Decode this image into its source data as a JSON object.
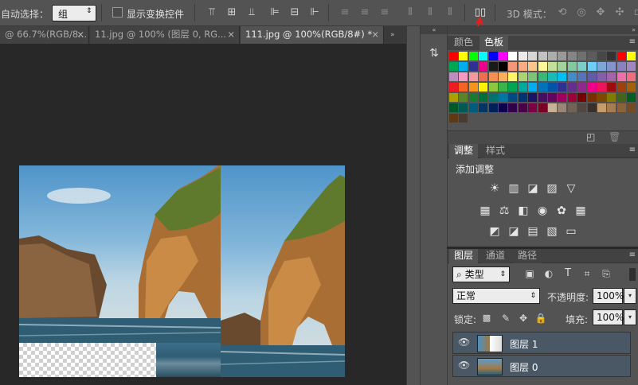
{
  "options_bar": {
    "auto_select_label": "自动选择：",
    "auto_select_value": "组",
    "show_transform_label": "显示变换控件",
    "mode_3d_label": "3D 模式："
  },
  "doc_tabs": [
    {
      "label": "@ 66.7%(RGB/8...",
      "close": "×"
    },
    {
      "label": "11.jpg @ 100% (图层 0, RG...",
      "close": "×"
    },
    {
      "label": "111.jpg @ 100%(RGB/8#) *",
      "close": "×"
    }
  ],
  "swatches_panel": {
    "tab_color": "颜色",
    "tab_swatches": "色板",
    "colors": [
      [
        "#ff0000",
        "#ffff00",
        "#00ff00",
        "#00ffff",
        "#0000ff",
        "#ff00ff",
        "#ffffff",
        "#ebebeb",
        "#d6d6d6",
        "#c2c2c2",
        "#adadad",
        "#999999",
        "#858585",
        "#707070",
        "#5c5c5c",
        "#474747",
        "#333333",
        "#ff0000",
        "#ffff00"
      ],
      [
        "#00a651",
        "#00aeef",
        "#2e3192",
        "#ec008c",
        "#1a1a1a",
        "#000000",
        "#f7977a",
        "#f9ad81",
        "#fdc68a",
        "#fff79a",
        "#c4df9b",
        "#a3d39c",
        "#82ca9d",
        "#7bcdc8",
        "#6ecff6",
        "#7ea7d8",
        "#8493ca",
        "#8882be",
        "#a187be"
      ],
      [
        "#bc8dbf",
        "#f49ac2",
        "#f6989d",
        "#f26c4f",
        "#f68e55",
        "#fbaf5c",
        "#fff467",
        "#acd372",
        "#7cc576",
        "#3bb878",
        "#1abbb4",
        "#00bff3",
        "#438cca",
        "#5574b9",
        "#605ca8",
        "#855fa8",
        "#a763a8",
        "#f06ea9",
        "#f26d7d"
      ],
      [
        "#ed1c24",
        "#f26522",
        "#f7941d",
        "#fff200",
        "#8dc73f",
        "#39b54a",
        "#00a651",
        "#00a99d",
        "#00aeef",
        "#0072bc",
        "#0054a6",
        "#2e3192",
        "#662d91",
        "#92278f",
        "#ec008c",
        "#ed145b",
        "#9e0b0f",
        "#a0410d",
        "#a36209"
      ],
      [
        "#aba000",
        "#598527",
        "#197b30",
        "#007236",
        "#00746b",
        "#0076a3",
        "#004a80",
        "#003471",
        "#1b1464",
        "#440e62",
        "#630460",
        "#9e005d",
        "#9e0039",
        "#790000",
        "#7b2e00",
        "#7d4900",
        "#827b00",
        "#406618",
        "#005e20"
      ],
      [
        "#005826",
        "#005952",
        "#005b7f",
        "#003663",
        "#002157",
        "#0d004c",
        "#32004b",
        "#4b0049",
        "#7b0046",
        "#7a0026",
        "#c7b299",
        "#998675",
        "#736357",
        "#534741",
        "#37302d",
        "#c69c6d",
        "#a67c52",
        "#8c6239",
        "#754c24"
      ],
      [
        "#603913",
        "#483c32"
      ]
    ]
  },
  "adjust_panel": {
    "tab_adjust": "调整",
    "tab_styles": "样式",
    "title": "添加调整",
    "row1": [
      "☀",
      "▥",
      "◪",
      "▨",
      "▽"
    ],
    "row2": [
      "▦",
      "⚖",
      "◧",
      "◉",
      "✿",
      "▦"
    ],
    "row3": [
      "◩",
      "◪",
      "▤",
      "▧",
      "▭"
    ]
  },
  "layers_panel": {
    "tab_layers": "图层",
    "tab_channels": "通道",
    "tab_paths": "路径",
    "filter_label": "类型",
    "blend_mode": "正常",
    "opacity_label": "不透明度:",
    "opacity_value": "100%",
    "lock_label": "锁定:",
    "fill_label": "填充:",
    "fill_value": "100%",
    "layers": [
      {
        "name": "图层 1",
        "visible": true
      },
      {
        "name": "图层 0",
        "visible": true
      }
    ]
  }
}
